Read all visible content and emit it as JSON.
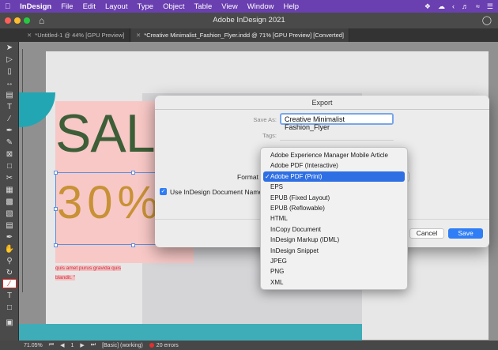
{
  "menubar": {
    "app_name": "InDesign",
    "items": [
      "File",
      "Edit",
      "Layout",
      "Type",
      "Object",
      "Table",
      "View",
      "Window",
      "Help"
    ],
    "right_icons": [
      "dropbox-icon",
      "cloud-icon",
      "chevron-icon",
      "sound-icon",
      "wifi-icon",
      "control-icon"
    ]
  },
  "window": {
    "title": "Adobe InDesign 2021"
  },
  "tabs": [
    {
      "label": "*Untitled-1 @ 44% [GPU Preview]"
    },
    {
      "label": "*Creative Minimalist_Fashion_Flyer.indd @ 71% [GPU Preview] [Converted]"
    }
  ],
  "document": {
    "sale_text": "SAL",
    "percent_text": "30%",
    "lorem_line1": "quis amet purus gravida quis",
    "lorem_line2": "blandit. \""
  },
  "statusbar": {
    "zoom": "71.05%",
    "page": "1",
    "style": "[Basic] (working)",
    "errors": "20 errors"
  },
  "export_dialog": {
    "title": "Export",
    "save_as_label": "Save As:",
    "save_as_value": "Creative Minimalist Fashion_Flyer",
    "tags_label": "Tags:",
    "format_label": "Format",
    "checkbox_label": "Use InDesign Document Name",
    "checkbox_checked": true,
    "cancel_label": "Cancel",
    "save_label": "Save"
  },
  "format_options": [
    "Adobe Experience Manager Mobile Article",
    "Adobe PDF (Interactive)",
    "Adobe PDF (Print)",
    "EPS",
    "EPUB (Fixed Layout)",
    "EPUB (Reflowable)",
    "HTML",
    "InCopy Document",
    "InDesign Markup (IDML)",
    "InDesign Snippet",
    "JPEG",
    "PNG",
    "XML"
  ],
  "selected_format": "Adobe PDF (Print)",
  "colors": {
    "menubar": "#6a3fb0",
    "accent": "#2f7ef5",
    "sale_green": "#3d5e37",
    "percent_gold": "#c89136",
    "pink": "#f7c8c6",
    "teal": "#22a6b3"
  }
}
